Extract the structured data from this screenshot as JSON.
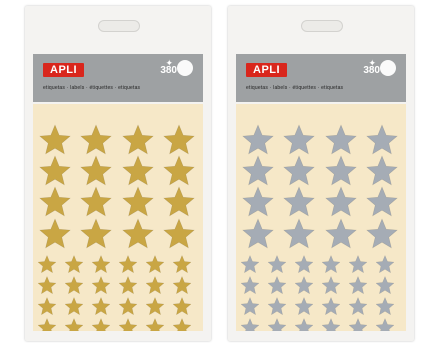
{
  "colors": {
    "gold": "#c9a644",
    "silver": "#a5acb5",
    "sheet": "#f6e8c8",
    "header": "#9ea1a3",
    "brand": "#d9261c"
  },
  "products": [
    {
      "brand": "APLI",
      "count": "380",
      "languages": "etiquetas · labels · étiquettes · etiquetas",
      "star_color": "gold"
    },
    {
      "brand": "APLI",
      "count": "380",
      "languages": "etiquetas · labels · étiquettes · etiquetas",
      "star_color": "silver"
    }
  ]
}
